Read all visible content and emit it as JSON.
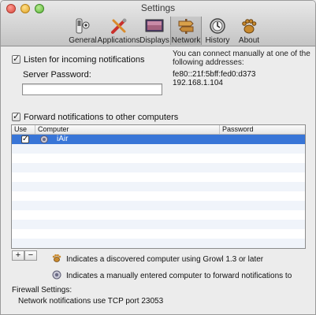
{
  "window": {
    "title": "Settings"
  },
  "toolbar": {
    "tabs": [
      {
        "label": "General",
        "icon": "switch-icon"
      },
      {
        "label": "Applications",
        "icon": "tools-icon"
      },
      {
        "label": "Displays",
        "icon": "display-icon"
      },
      {
        "label": "Network",
        "icon": "signpost-icon",
        "selected": true
      },
      {
        "label": "History",
        "icon": "history-icon"
      },
      {
        "label": "About",
        "icon": "paw-icon"
      }
    ]
  },
  "listen": {
    "checkbox_label": "Listen for incoming notifications",
    "checked": true,
    "password_label": "Server Password:",
    "password_value": "",
    "info_text_line1": "You can connect manually at one of the",
    "info_text_line2": "following addresses:",
    "addresses": [
      "fe80::21f:5bff:fed0:d373",
      "192.168.1.104"
    ]
  },
  "forward": {
    "checkbox_label": "Forward notifications to other computers",
    "checked": true,
    "columns": [
      "Use",
      "Computer",
      "Password"
    ],
    "rows": [
      {
        "use": true,
        "computer": "iAir",
        "password": "",
        "selected": true
      }
    ],
    "add_label": "+",
    "remove_label": "−"
  },
  "legend": {
    "discovered": "Indicates a discovered computer using Growl 1.3 or later",
    "manual": "Indicates a manually entered computer to forward notifications to"
  },
  "firewall": {
    "heading": "Firewall Settings:",
    "detail": "Network notifications use TCP port 23053"
  },
  "colors": {
    "selection": "#3875d7",
    "window_bg": "#ececec"
  }
}
